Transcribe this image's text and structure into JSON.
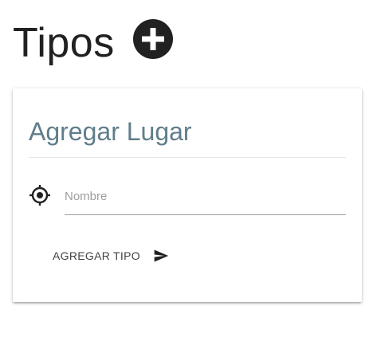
{
  "header": {
    "title": "Tipos",
    "add_icon": "add-circle-icon"
  },
  "card": {
    "title": "Agregar Lugar",
    "name_field": {
      "icon": "gps-target-icon",
      "placeholder": "Nombre",
      "value": ""
    },
    "submit": {
      "label": "AGREGAR TIPO",
      "icon": "send-icon"
    }
  },
  "colors": {
    "title_text": "#212121",
    "card_title": "#607d8b",
    "icon_dark": "#212121",
    "underline": "#9e9e9e",
    "placeholder": "#9e9e9e"
  }
}
